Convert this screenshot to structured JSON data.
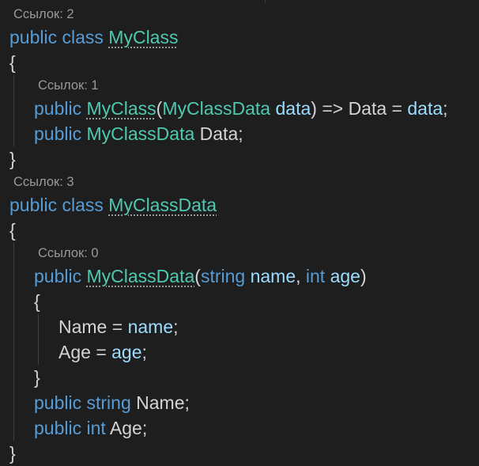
{
  "editor": {
    "lines": [
      {
        "type": "lens",
        "text": "Ссылок: 2"
      },
      {
        "type": "code",
        "tokens": [
          {
            "text": "public",
            "kind": "kw"
          },
          {
            "text": " ",
            "kind": "tx"
          },
          {
            "text": "class",
            "kind": "kw"
          },
          {
            "text": " ",
            "kind": "tx"
          },
          {
            "text": "MyClass",
            "kind": "ty",
            "dotted": true
          }
        ]
      },
      {
        "type": "code",
        "tokens": [
          {
            "text": "{",
            "kind": "tx"
          }
        ]
      },
      {
        "type": "lens",
        "indent": 1,
        "text": "Ссылок: 1"
      },
      {
        "type": "code",
        "indent": 1,
        "tokens": [
          {
            "text": "public",
            "kind": "kw"
          },
          {
            "text": " ",
            "kind": "tx"
          },
          {
            "text": "MyClass",
            "kind": "ty",
            "dotted": true
          },
          {
            "text": "(",
            "kind": "tx"
          },
          {
            "text": "MyClassData",
            "kind": "ty"
          },
          {
            "text": " ",
            "kind": "tx"
          },
          {
            "text": "data",
            "kind": "id"
          },
          {
            "text": ") => Data = ",
            "kind": "tx"
          },
          {
            "text": "data",
            "kind": "id"
          },
          {
            "text": ";",
            "kind": "tx"
          }
        ]
      },
      {
        "type": "code",
        "indent": 1,
        "tokens": [
          {
            "text": "public",
            "kind": "kw"
          },
          {
            "text": " ",
            "kind": "tx"
          },
          {
            "text": "MyClassData",
            "kind": "ty"
          },
          {
            "text": " Data;",
            "kind": "tx"
          }
        ]
      },
      {
        "type": "code",
        "tokens": [
          {
            "text": "}",
            "kind": "tx"
          }
        ]
      },
      {
        "type": "lens",
        "text": "Ссылок: 3"
      },
      {
        "type": "code",
        "tokens": [
          {
            "text": "public",
            "kind": "kw"
          },
          {
            "text": " ",
            "kind": "tx"
          },
          {
            "text": "class",
            "kind": "kw"
          },
          {
            "text": " ",
            "kind": "tx"
          },
          {
            "text": "MyClassData",
            "kind": "ty",
            "dotted": true
          }
        ]
      },
      {
        "type": "code",
        "tokens": [
          {
            "text": "{",
            "kind": "tx"
          }
        ]
      },
      {
        "type": "lens",
        "indent": 1,
        "text": "Ссылок: 0"
      },
      {
        "type": "code",
        "indent": 1,
        "tokens": [
          {
            "text": "public",
            "kind": "kw"
          },
          {
            "text": " ",
            "kind": "tx"
          },
          {
            "text": "MyClassData",
            "kind": "ty",
            "dotted": true
          },
          {
            "text": "(",
            "kind": "tx"
          },
          {
            "text": "string",
            "kind": "kw"
          },
          {
            "text": " ",
            "kind": "tx"
          },
          {
            "text": "name",
            "kind": "id"
          },
          {
            "text": ", ",
            "kind": "tx"
          },
          {
            "text": "int",
            "kind": "kw"
          },
          {
            "text": " ",
            "kind": "tx"
          },
          {
            "text": "age",
            "kind": "id"
          },
          {
            "text": ")",
            "kind": "tx"
          }
        ]
      },
      {
        "type": "code",
        "indent": 1,
        "tokens": [
          {
            "text": "{",
            "kind": "tx"
          }
        ]
      },
      {
        "type": "code",
        "indent": 2,
        "tokens": [
          {
            "text": "Name = ",
            "kind": "tx"
          },
          {
            "text": "name",
            "kind": "id"
          },
          {
            "text": ";",
            "kind": "tx"
          }
        ]
      },
      {
        "type": "code",
        "indent": 2,
        "tokens": [
          {
            "text": "Age = ",
            "kind": "tx"
          },
          {
            "text": "age",
            "kind": "id"
          },
          {
            "text": ";",
            "kind": "tx"
          }
        ]
      },
      {
        "type": "code",
        "indent": 1,
        "tokens": [
          {
            "text": "}",
            "kind": "tx"
          }
        ]
      },
      {
        "type": "code",
        "indent": 1,
        "tokens": [
          {
            "text": "public",
            "kind": "kw"
          },
          {
            "text": " ",
            "kind": "tx"
          },
          {
            "text": "string",
            "kind": "kw"
          },
          {
            "text": " Name;",
            "kind": "tx"
          }
        ]
      },
      {
        "type": "code",
        "indent": 1,
        "tokens": [
          {
            "text": "public",
            "kind": "kw"
          },
          {
            "text": " ",
            "kind": "tx"
          },
          {
            "text": "int",
            "kind": "kw"
          },
          {
            "text": " Age;",
            "kind": "tx"
          }
        ]
      },
      {
        "type": "code",
        "tokens": [
          {
            "text": "}",
            "kind": "tx"
          }
        ]
      }
    ]
  },
  "colors": {
    "background": "#1e1e1e",
    "keyword": "#569cd6",
    "type": "#4ec9b0",
    "identifier": "#9cdcfe",
    "text": "#d4d4d4",
    "codelens": "#999999"
  }
}
